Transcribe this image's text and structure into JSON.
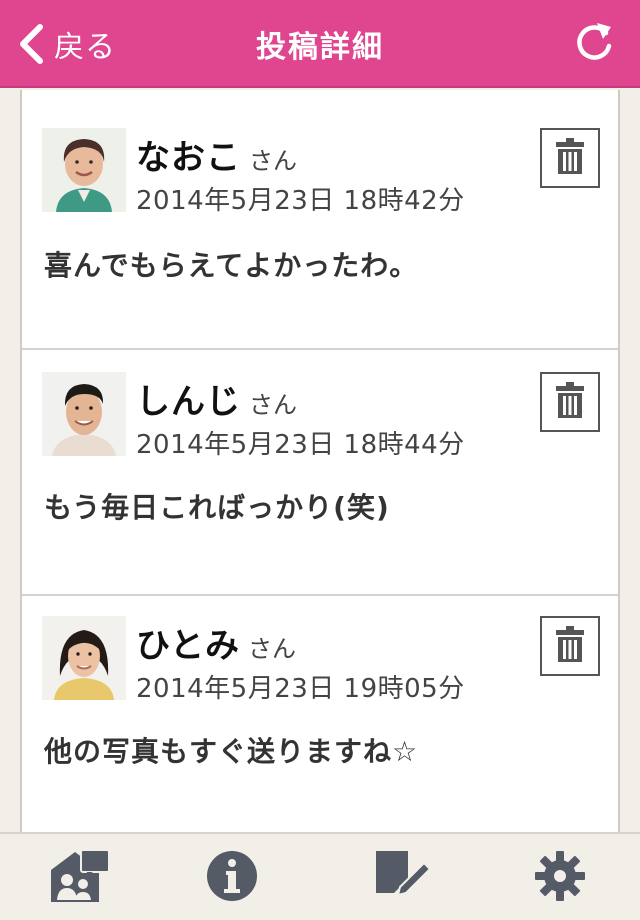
{
  "header": {
    "back_label": "戻る",
    "title": "投稿詳細"
  },
  "colors": {
    "accent": "#e0458f",
    "icon_gray": "#545b66"
  },
  "posts": [
    {
      "author": "なおこ",
      "suffix": "さん",
      "timestamp": "2014年5月23日 18時42分",
      "body": "喜んでもらえてよかったわ。",
      "avatar": "avatar-elderly-woman"
    },
    {
      "author": "しんじ",
      "suffix": "さん",
      "timestamp": "2014年5月23日 18時44分",
      "body": "もう毎日こればっかり(笑)",
      "avatar": "avatar-young-man"
    },
    {
      "author": "ひとみ",
      "suffix": "さん",
      "timestamp": "2014年5月23日 19時05分",
      "body": "他の写真もすぐ送りますね☆",
      "avatar": "avatar-young-woman"
    }
  ],
  "tabbar": {
    "items": [
      "family-icon",
      "info-icon",
      "compose-icon",
      "gear-icon"
    ]
  }
}
